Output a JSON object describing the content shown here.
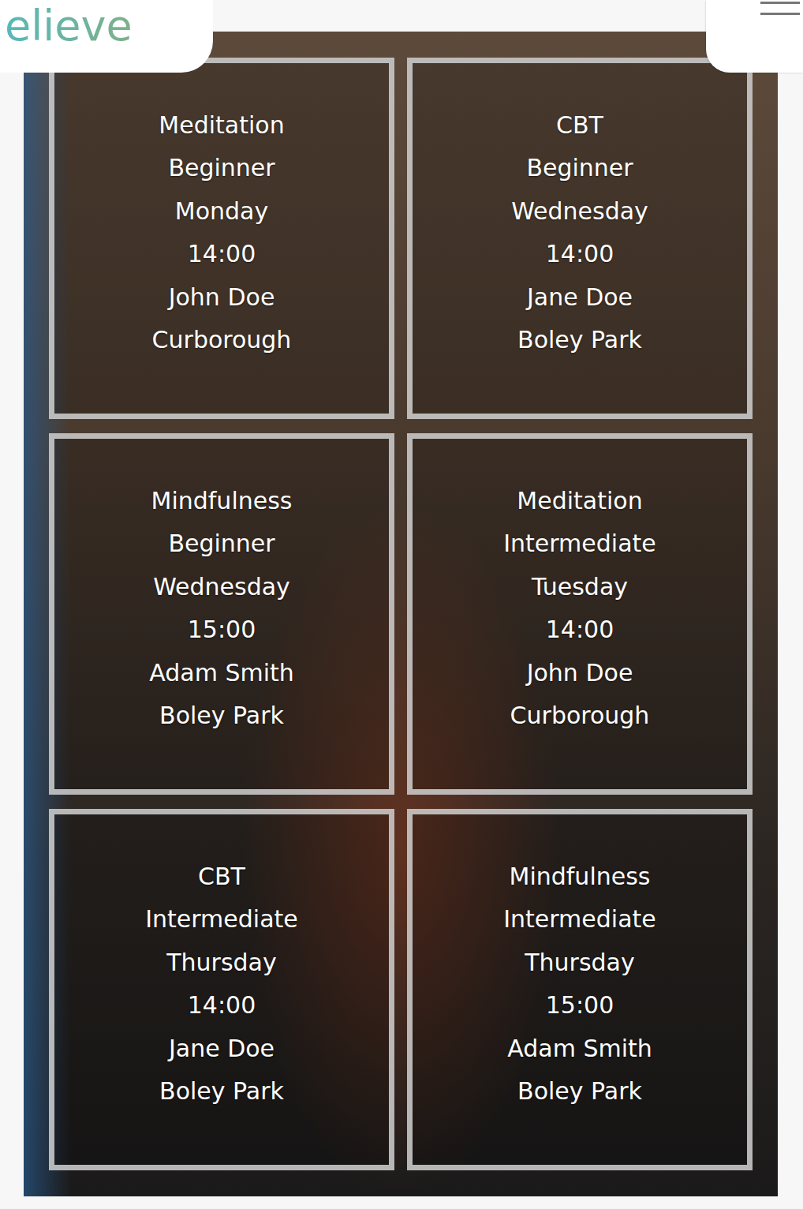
{
  "header": {
    "logo": "elieve"
  },
  "classes": [
    {
      "name": "Meditation",
      "level": "Beginner",
      "day": "Monday",
      "time": "14:00",
      "instructor": "John Doe",
      "location": "Curborough"
    },
    {
      "name": "CBT",
      "level": "Beginner",
      "day": "Wednesday",
      "time": "14:00",
      "instructor": "Jane Doe",
      "location": "Boley Park"
    },
    {
      "name": "Mindfulness",
      "level": "Beginner",
      "day": "Wednesday",
      "time": "15:00",
      "instructor": "Adam Smith",
      "location": "Boley Park"
    },
    {
      "name": "Meditation",
      "level": "Intermediate",
      "day": "Tuesday",
      "time": "14:00",
      "instructor": "John Doe",
      "location": "Curborough"
    },
    {
      "name": "CBT",
      "level": "Intermediate",
      "day": "Thursday",
      "time": "14:00",
      "instructor": "Jane Doe",
      "location": "Boley Park"
    },
    {
      "name": "Mindfulness",
      "level": "Intermediate",
      "day": "Thursday",
      "time": "15:00",
      "instructor": "Adam Smith",
      "location": "Boley Park"
    }
  ]
}
